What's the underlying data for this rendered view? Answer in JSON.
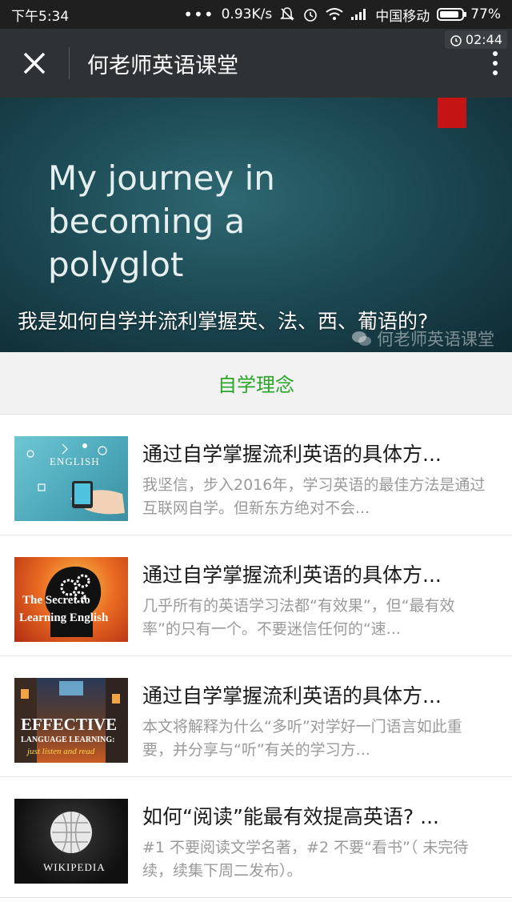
{
  "status_bar": {
    "time": "下午5:34",
    "network_speed": "0.93K/s",
    "carrier": "中国移动",
    "battery": "77%"
  },
  "top_bar": {
    "title": "何老师英语课堂",
    "timer": "02:44"
  },
  "hero": {
    "slide_text": "My journey in\nbecoming a\npolyglot",
    "caption": "我是如何自学并流利掌握英、法、西、葡语的?",
    "watermark": "何老师英语课堂"
  },
  "section": {
    "title": "自学理念",
    "accent_color": "#2aa52a"
  },
  "articles": [
    {
      "title": "通过自学掌握流利英语的具体方...",
      "desc": "我坚信，步入2016年，学习英语的最佳方法是通过互联网自学。但新东方绝对不会...",
      "thumb_label": "ENGLISH"
    },
    {
      "title": "通过自学掌握流利英语的具体方...",
      "desc": "几乎所有的英语学习法都“有效果”，但“最有效率”的只有一个。不要迷信任何的“速...",
      "thumb_label_1": "The Secret to",
      "thumb_label_2": "Learning English"
    },
    {
      "title": "通过自学掌握流利英语的具体方...",
      "desc": "本文将解释为什么“多听”对学好一门语言如此重要，并分享与“听”有关的学习方...",
      "thumb_label_1": "EFFECTIVE",
      "thumb_label_2": "LANGUAGE LEARNING:",
      "thumb_label_3": "just listen and read"
    },
    {
      "title": "如何“阅读”能最有效提高英语? ...",
      "desc": "#1 不要阅读文学名著，#2 不要“看书”（ 未完待续，续集下周二发布）。",
      "thumb_label": "WIKIPEDIA"
    }
  ]
}
